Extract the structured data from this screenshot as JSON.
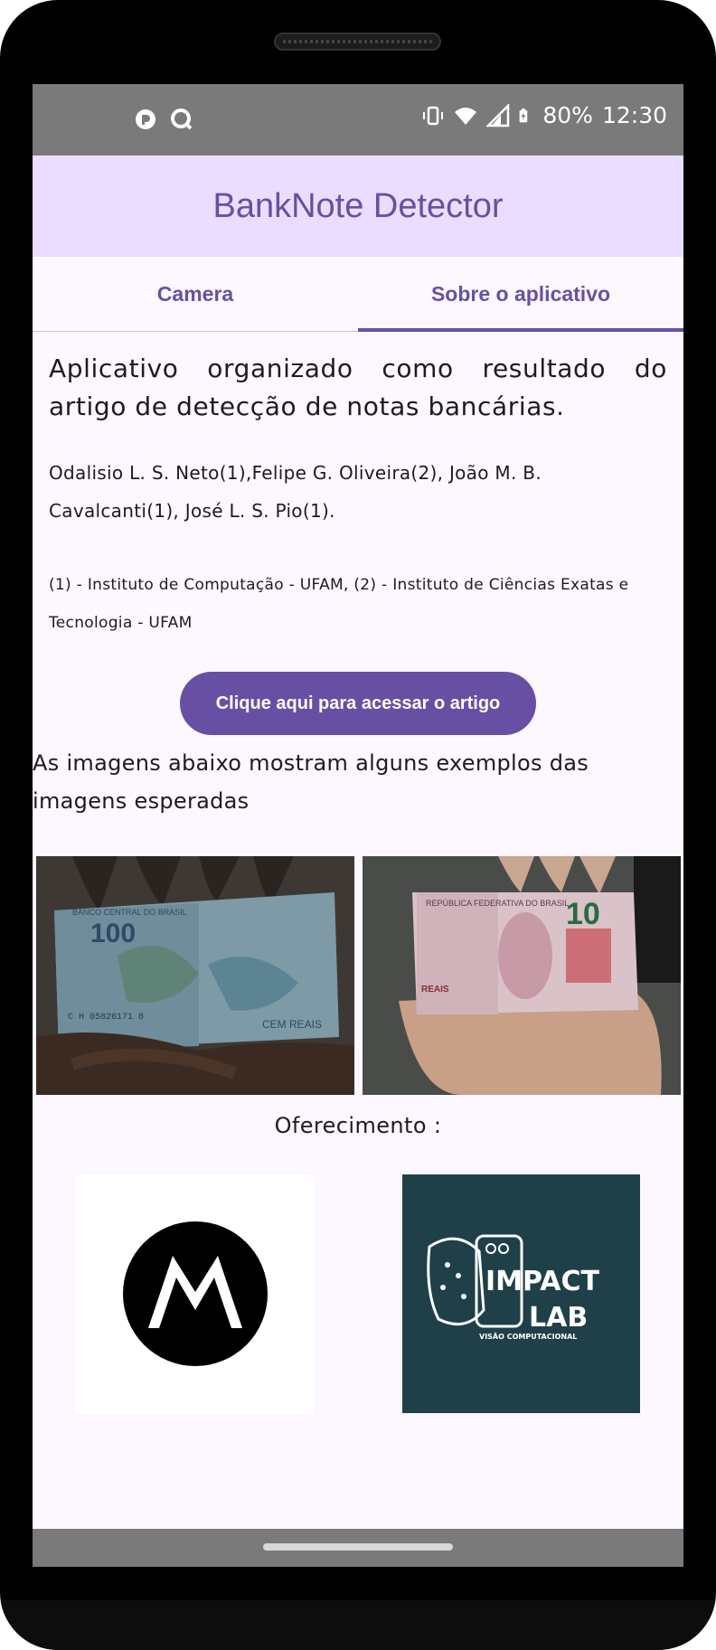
{
  "status_bar": {
    "battery": "80%",
    "time": "12:30",
    "left_icons": [
      "notification-app-icon",
      "search-app-icon"
    ],
    "right_icons": [
      "vibrate-icon",
      "wifi-icon",
      "signal-icon",
      "battery-charging-icon"
    ]
  },
  "app_bar": {
    "title": "BankNote Detector"
  },
  "tabs": [
    {
      "label": "Camera",
      "active": false
    },
    {
      "label": "Sobre o aplicativo",
      "active": true
    }
  ],
  "about": {
    "intro": "Aplicativo organizado como resultado do artigo de detecção de notas bancárias.",
    "authors": "Odalisio L. S. Neto(1),Felipe G. Oliveira(2), João M. B. Cavalcanti(1), José L. S. Pio(1).",
    "affiliations": "(1) - Instituto de Computação - UFAM, (2) - Instituto de Ciências Exatas e Tecnologia - UFAM",
    "article_button": "Clique aqui para acessar o artigo",
    "examples_text": "As imagens abaixo mostram alguns exemplos das imagens esperadas",
    "examples": [
      {
        "note_value": "100",
        "note_text": "CEM REAIS",
        "serial": "C H 05826171 8",
        "bank_text": "BANCO CENTRAL DO BRASIL"
      },
      {
        "note_value": "10",
        "note_text": "REAIS",
        "bank_text": "REPÚBLICA FEDERATIVA DO BRASIL"
      }
    ],
    "sponsor_label": "Oferecimento :",
    "sponsors": [
      {
        "name": "motorola-logo"
      },
      {
        "name": "impact-lab-logo",
        "line1": "IMPACT",
        "line2": "LAB",
        "tagline": "VISÃO COMPUTACIONAL"
      }
    ]
  },
  "colors": {
    "primary": "#6750a4",
    "app_bar_bg": "#eaddff",
    "background": "#fdf7ff",
    "status_bar_bg": "#7a7a7a",
    "impact_bg": "#1f4049"
  }
}
